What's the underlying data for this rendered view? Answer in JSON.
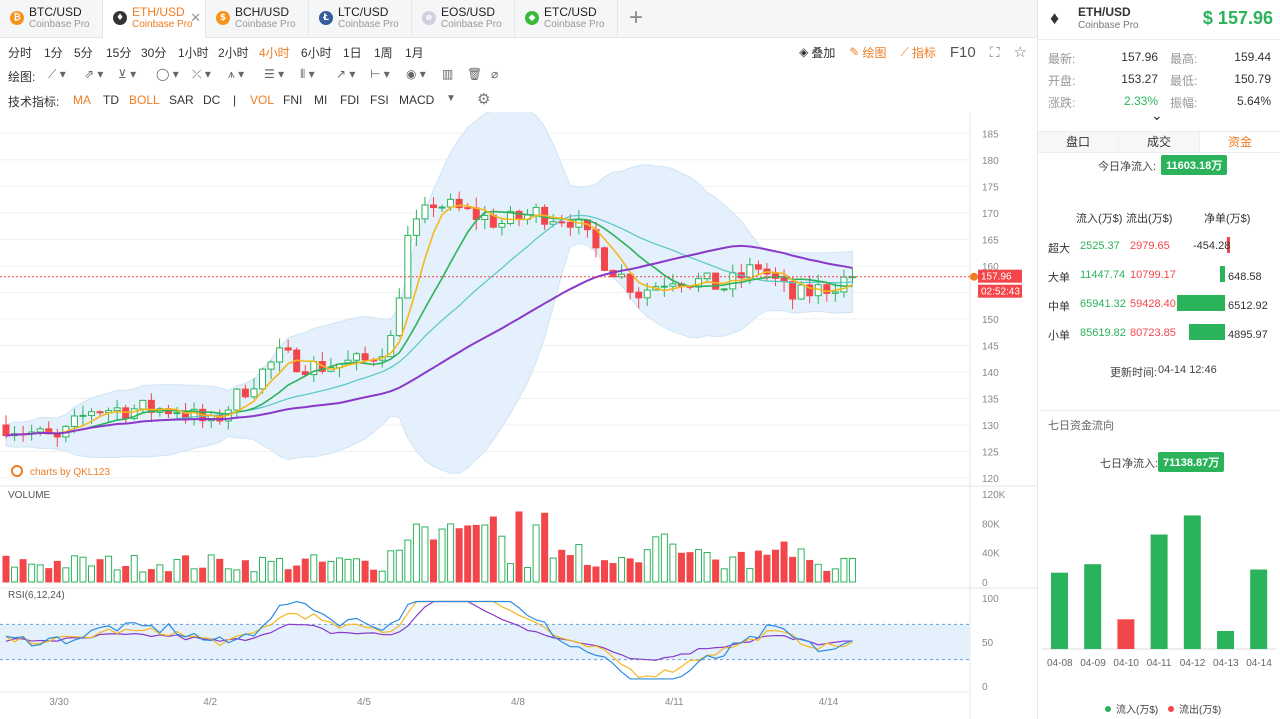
{
  "tabs": [
    {
      "symbol": "BTC/USD",
      "exchange": "Coinbase Pro",
      "coin_color": "#f7931a",
      "icon": "bitcoin-icon",
      "glyph": "₿",
      "active": false
    },
    {
      "symbol": "ETH/USD",
      "exchange": "Coinbase Pro",
      "coin_color": "#333333",
      "icon": "ethereum-icon",
      "glyph": "♦",
      "active": true
    },
    {
      "symbol": "BCH/USD",
      "exchange": "Coinbase Pro",
      "coin_color": "#f7931a",
      "icon": "bitcoin-cash-icon",
      "glyph": "$",
      "active": false
    },
    {
      "symbol": "LTC/USD",
      "exchange": "Coinbase Pro",
      "coin_color": "#345d9d",
      "icon": "litecoin-icon",
      "glyph": "Ł",
      "active": false
    },
    {
      "symbol": "EOS/USD",
      "exchange": "Coinbase Pro",
      "coin_color": "#cfcfe0",
      "icon": "eos-icon",
      "glyph": "e",
      "active": false
    },
    {
      "symbol": "ETC/USD",
      "exchange": "Coinbase Pro",
      "coin_color": "#3ab83a",
      "icon": "ethereum-classic-icon",
      "glyph": "◆",
      "active": false
    }
  ],
  "intervals": [
    "分时",
    "1分",
    "5分",
    "15分",
    "30分",
    "1小时",
    "2小时",
    "4小时",
    "6小时",
    "1日",
    "1周",
    "1月"
  ],
  "active_interval": "4小时",
  "toolbar": {
    "overlay": "叠加",
    "draw": "绘图",
    "indicator": "指标",
    "f10": "F10"
  },
  "draw_label": "绘图:",
  "indicator_label": "技术指标:",
  "indicators": [
    {
      "label": "MA",
      "on": true
    },
    {
      "label": "TD",
      "on": false
    },
    {
      "label": "BOLL",
      "on": true
    },
    {
      "label": "SAR",
      "on": false
    },
    {
      "label": "DC",
      "on": false
    },
    {
      "label": "|",
      "on": false
    },
    {
      "label": "VOL",
      "on": true
    },
    {
      "label": "FNI",
      "on": false
    },
    {
      "label": "MI",
      "on": false
    },
    {
      "label": "FDI",
      "on": false
    },
    {
      "label": "FSI",
      "on": false
    },
    {
      "label": "MACD",
      "on": false
    }
  ],
  "chart": {
    "watermark": "charts by QKL123",
    "price_ticks": [
      185,
      180,
      175,
      170,
      165,
      160,
      155,
      150,
      145,
      140,
      135,
      130,
      125,
      120
    ],
    "price_range": [
      120,
      186
    ],
    "last_price": "157.96",
    "countdown": "02:52:43",
    "volume_label": "VOLUME",
    "volume_ticks": [
      "120K",
      "80K",
      "40K",
      "0"
    ],
    "volume_max": 120000,
    "rsi_label": "RSI(6,12,24)",
    "rsi_ticks": [
      "100",
      "50",
      "0"
    ],
    "rsi_bands": [
      70,
      30
    ],
    "date_labels": [
      {
        "label": "3/30",
        "index": 6
      },
      {
        "label": "4/2",
        "index": 24
      },
      {
        "label": "4/5",
        "index": 42
      },
      {
        "label": "4/8",
        "index": 60
      },
      {
        "label": "4/11",
        "index": 78
      },
      {
        "label": "4/14",
        "index": 96
      }
    ],
    "colors": {
      "up": "#2bb35b",
      "down": "#f2464b",
      "ma5": "#f5b81c",
      "ma10": "#2bb35b",
      "ma30": "#56c7c7",
      "ma60": "#8a39c9",
      "boll": "#cfe4f5"
    }
  },
  "right": {
    "symbol": "ETH/USD",
    "exchange": "Coinbase Pro",
    "price": "$ 157.96",
    "stats": [
      {
        "label": "最新:",
        "value": "157.96",
        "label2": "最高:",
        "value2": "159.44"
      },
      {
        "label": "开盘:",
        "value": "153.27",
        "label2": "最低:",
        "value2": "150.79"
      },
      {
        "label": "涨跌:",
        "value": "2.33%",
        "label2": "振幅:",
        "value2": "5.64%"
      }
    ],
    "tabs": [
      "盘口",
      "成交",
      "资金"
    ],
    "active_tab": "资金",
    "today_label": "今日净流入:",
    "today_value": "11603.18万",
    "flow_headers": [
      "流入(万$)",
      "流出(万$)",
      "净单(万$)"
    ],
    "flows": [
      {
        "name": "超大",
        "in": "2525.37",
        "out": "2979.65",
        "net": "-454.28",
        "net_value": -454.28
      },
      {
        "name": "大单",
        "in": "11447.74",
        "out": "10799.17",
        "net": "648.58",
        "net_value": 648.58
      },
      {
        "name": "中单",
        "in": "65941.32",
        "out": "59428.40",
        "net": "6512.92",
        "net_value": 6512.92
      },
      {
        "name": "小单",
        "in": "85619.82",
        "out": "80723.85",
        "net": "4895.97",
        "net_value": 4895.97
      }
    ],
    "update_label": "更新时间:",
    "update_time": "04-14 12:46",
    "seven_title": "七日资金流向",
    "seven_label": "七日净流入:",
    "seven_value": "71138.87万",
    "seven_days": [
      {
        "date": "04-08",
        "value": 72,
        "dir": "in"
      },
      {
        "date": "04-09",
        "value": 80,
        "dir": "in"
      },
      {
        "date": "04-10",
        "value": 28,
        "dir": "out"
      },
      {
        "date": "04-11",
        "value": 108,
        "dir": "in"
      },
      {
        "date": "04-12",
        "value": 126,
        "dir": "in"
      },
      {
        "date": "04-13",
        "value": 17,
        "dir": "in"
      },
      {
        "date": "04-14",
        "value": 75,
        "dir": "in"
      }
    ],
    "legend_in": "流入(万$)",
    "legend_out": "流出(万$)"
  }
}
